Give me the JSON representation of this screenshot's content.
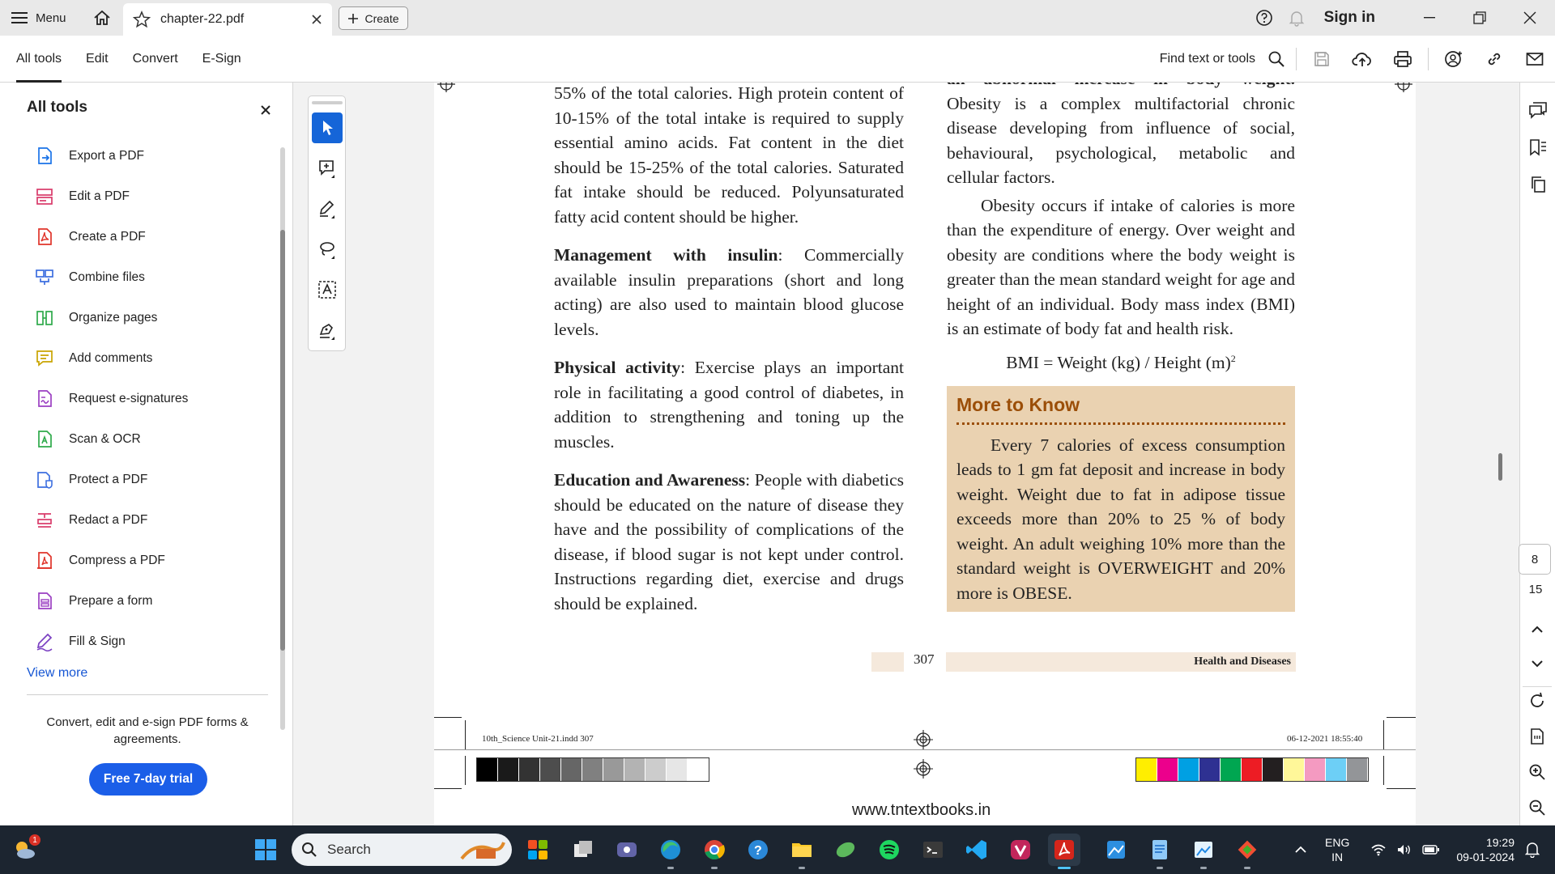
{
  "titlebar": {
    "menu_label": "Menu",
    "tab_title": "chapter-22.pdf",
    "create_label": "Create",
    "signin_label": "Sign in"
  },
  "toolbar": {
    "tabs": [
      "All tools",
      "Edit",
      "Convert",
      "E-Sign"
    ],
    "find_label": "Find text or tools"
  },
  "left_panel": {
    "title": "All tools",
    "items": [
      {
        "label": "Export a PDF",
        "icon": "export-pdf-icon",
        "color": "#1a73e8"
      },
      {
        "label": "Edit a PDF",
        "icon": "edit-pdf-icon",
        "color": "#d93a6a"
      },
      {
        "label": "Create a PDF",
        "icon": "create-pdf-icon",
        "color": "#e0342a"
      },
      {
        "label": "Combine files",
        "icon": "combine-files-icon",
        "color": "#3d6fe0"
      },
      {
        "label": "Organize pages",
        "icon": "organize-pages-icon",
        "color": "#2eaa4a"
      },
      {
        "label": "Add comments",
        "icon": "add-comments-icon",
        "color": "#c9a400"
      },
      {
        "label": "Request e-signatures",
        "icon": "request-esignatures-icon",
        "color": "#9b3fc2"
      },
      {
        "label": "Scan & OCR",
        "icon": "scan-ocr-icon",
        "color": "#2eaa4a"
      },
      {
        "label": "Protect a PDF",
        "icon": "protect-pdf-icon",
        "color": "#3d6fe0"
      },
      {
        "label": "Redact a PDF",
        "icon": "redact-pdf-icon",
        "color": "#d93a6a"
      },
      {
        "label": "Compress a PDF",
        "icon": "compress-pdf-icon",
        "color": "#e0342a"
      },
      {
        "label": "Prepare a form",
        "icon": "prepare-form-icon",
        "color": "#9b3fc2"
      },
      {
        "label": "Fill & Sign",
        "icon": "fill-sign-icon",
        "color": "#7a3fc2"
      }
    ],
    "view_more": "View more",
    "promo_text": "Convert, edit and e-sign PDF forms & agreements.",
    "trial_button": "Free 7-day trial"
  },
  "document": {
    "left_column": {
      "intro": "55% of the total calories. High protein content of 10-15% of the total intake is required to supply essential amino acids. Fat content in the diet should be 15-25% of the total calories. Saturated fat intake should be reduced. Polyunsaturated fatty acid content should be higher.",
      "paragraphs": [
        {
          "heading": "Management with insulin",
          "text": ": Commercially available insulin preparations (short and long acting) are also used to maintain blood glucose levels."
        },
        {
          "heading": "Physical activity",
          "text": ": Exercise plays an important role in facilitating a good control of diabetes, in addition to strengthening and toning up the muscles."
        },
        {
          "heading": "Education and Awareness",
          "text": ": People with diabetics should be educated on the nature of disease they have and the possibility of complications of the disease, if blood sugar is not kept under control. Instructions regarding diet, exercise and drugs should be explained."
        }
      ]
    },
    "right_column": {
      "cut_line": "an abnormal increase in body weight.",
      "para1_rest": "Obesity is a complex multifactorial chronic disease developing from influence of social, behavioural, psychological, metabolic and cellular factors.",
      "para2": "Obesity occurs if intake of calories is more than the expenditure of energy. Over weight and obesity are conditions where the body weight is greater than the mean standard weight for age and height of an individual. Body mass index (BMI) is an estimate of body fat and health risk.",
      "formula": "BMI = Weight (kg) / Height (m)",
      "formula_sup": "2",
      "box_title": "More to Know",
      "box_text": "Every 7 calories of excess consumption leads to 1 gm fat deposit and increase in body weight. Weight due to fat in adipose tissue exceeds more than 20% to 25 % of body weight. An adult weighing 10% more than the standard weight is OVERWEIGHT and 20% more is OBESE."
    },
    "page_number": "307",
    "footer_title": "Health and Diseases",
    "slug_left": "10th_Science Unit-21.indd   307",
    "slug_right": "06-12-2021   18:55:40",
    "website": "www.tntextbooks.in",
    "gray_swatches": [
      "#000000",
      "#1a1a1a",
      "#333333",
      "#4d4d4d",
      "#666666",
      "#808080",
      "#999999",
      "#b3b3b3",
      "#cccccc",
      "#e6e6e6",
      "#ffffff"
    ],
    "color_swatches": [
      "#ffee00",
      "#ec008c",
      "#00a0e3",
      "#2e3192",
      "#00a651",
      "#ed1c24",
      "#231f20",
      "#fff799",
      "#f49ac1",
      "#6dcff6",
      "#939598"
    ]
  },
  "right_rail": {
    "current_page": "8",
    "total_pages": "15"
  },
  "taskbar": {
    "search_placeholder": "Search",
    "lang_top": "ENG",
    "lang_bottom": "IN",
    "time": "19:29",
    "date": "09-01-2024",
    "weather_badge": "1"
  },
  "colors": {
    "accent": "#1b5ee8",
    "selected_tool": "#1565d8",
    "box_bg": "#ead2b1",
    "box_title": "#9b4e08",
    "taskbar": "#1c2530"
  }
}
